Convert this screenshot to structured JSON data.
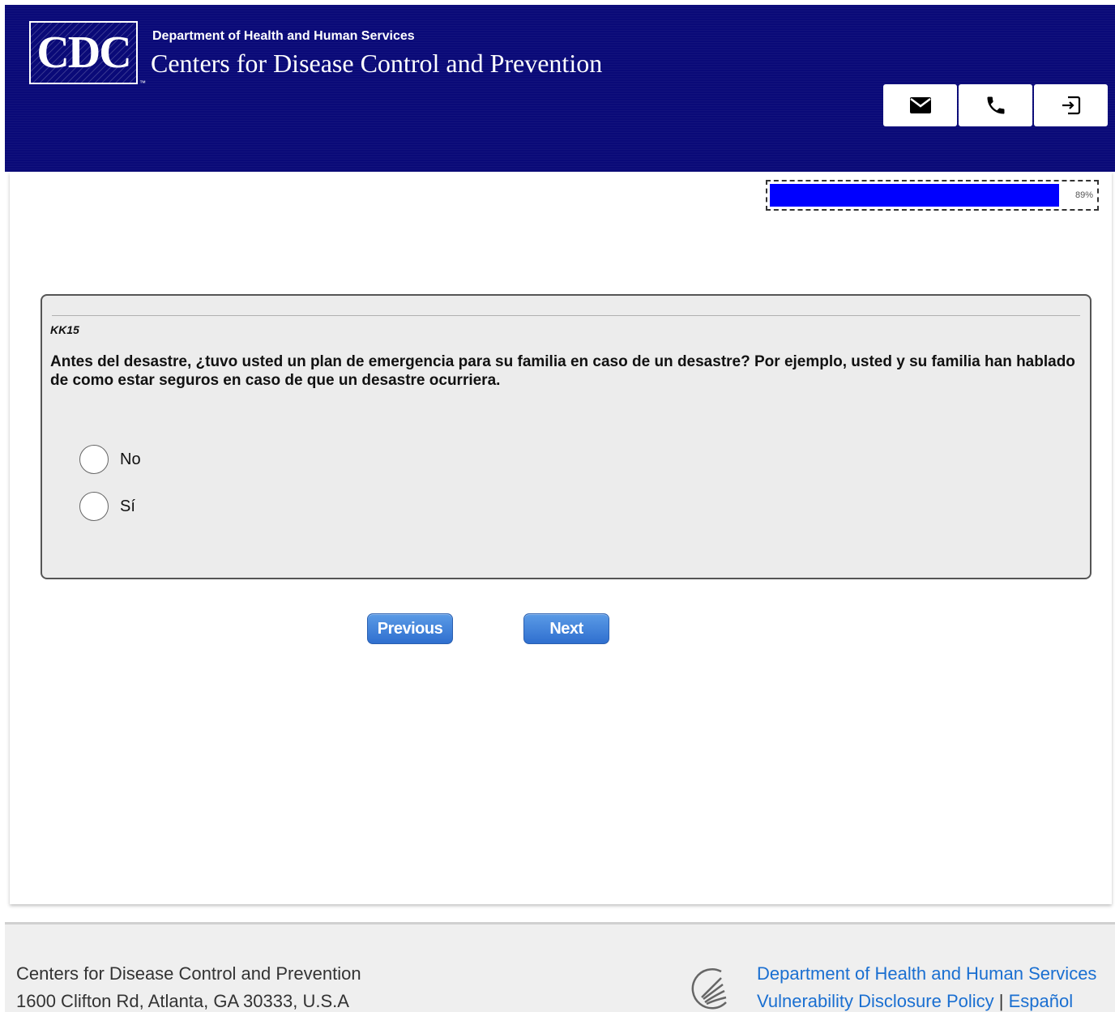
{
  "header": {
    "logo_text": "CDC",
    "logo_tm": "™",
    "department": "Department of Health and Human Services",
    "agency": "Centers for Disease Control and Prevention",
    "buttons": [
      {
        "icon": "mail-icon"
      },
      {
        "icon": "phone-icon"
      },
      {
        "icon": "exit-icon"
      }
    ],
    "brand_color": "#0a0a78"
  },
  "progress": {
    "value_percent": 89,
    "label": "89%",
    "fill_color": "#0000ff"
  },
  "question": {
    "id": "KK15",
    "text": "Antes del desastre, ¿tuvo usted un plan de emergencia para su familia en caso de un desastre? Por ejemplo, usted y su familia han hablado de como estar seguros en caso de que un desastre ocurriera.",
    "options": [
      {
        "label": "No",
        "selected": false
      },
      {
        "label": "Sí",
        "selected": false
      }
    ]
  },
  "nav": {
    "previous_label": "Previous",
    "next_label": "Next"
  },
  "footer": {
    "org_name": "Centers for Disease Control and Prevention",
    "address": "1600 Clifton Rd, Atlanta, GA 30333, U.S.A",
    "hhs_link": "Department of Health and Human Services",
    "vdp_link": "Vulnerability Disclosure Policy",
    "separator": " | ",
    "spanish_link": "Español",
    "link_color": "#1a6fd1"
  }
}
